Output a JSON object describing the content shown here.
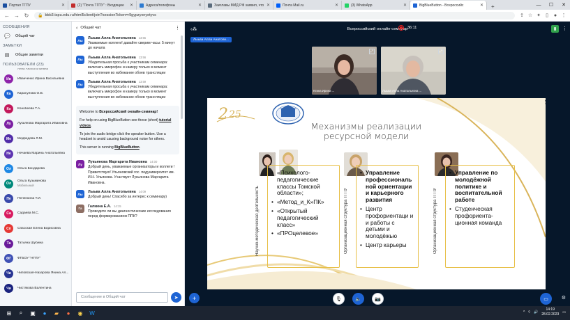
{
  "browser": {
    "tabs": [
      {
        "label": "Портал ТГПУ",
        "color": "#1b4fa0",
        "active": false
      },
      {
        "label": "(2) \"Почта ТГПУ\" : Входящие",
        "color": "#c22d2d",
        "active": false
      },
      {
        "label": "Адреса/телефоны",
        "color": "#2e7bd1",
        "active": false
      },
      {
        "label": "Заиглавы МИД РФ заявил, что",
        "color": "#5a6b7c",
        "active": false
      },
      {
        "label": "Почта Mail.ru",
        "color": "#005ff9",
        "active": false
      },
      {
        "label": "(3) WhatsApp",
        "color": "#25d366",
        "active": false
      },
      {
        "label": "BigBlueButton - Всероссийс",
        "color": "#1e64d4",
        "active": true
      }
    ],
    "url": "bbb3.tspu.edu.ru/html5client/join?sessionToken=r9gypzyxnyetyvs"
  },
  "sidebar": {
    "messages_header": "СООБЩЕНИЯ",
    "public_chat": "Общий чат",
    "notes_header": "ЗАМЕТКИ",
    "shared_notes": "Общие заметки",
    "users_header": "ПОЛЬЗОВАТЕЛИ (23)",
    "partial_user": "Анна Аналатольевна",
    "users": [
      {
        "initials": "Ив",
        "name": "Иванченко Ирина Васильевна",
        "sub": "",
        "color": "#8e24aa",
        "round": true
      },
      {
        "initials": "Ка",
        "name": "Карасулова О.В.",
        "sub": "",
        "color": "#1e64d4",
        "round": true
      },
      {
        "initials": "Ко",
        "name": "Конобеева Т.А.",
        "sub": "",
        "color": "#c2185b",
        "round": true
      },
      {
        "initials": "Лу",
        "name": "Лукьянова Маргарита Ивановна",
        "sub": "",
        "color": "#7b1fa2",
        "round": true
      },
      {
        "initials": "Ме",
        "name": "Медведева Л.М.",
        "sub": "",
        "color": "#512da8",
        "round": true
      },
      {
        "initials": "Не",
        "name": "Нечаева Марина Анатольевна",
        "sub": "",
        "color": "#5e35b1",
        "round": true
      },
      {
        "initials": "Ол",
        "name": "Ольга Бондарева",
        "sub": "",
        "color": "#1e88e5",
        "round": true
      },
      {
        "initials": "Ол",
        "name": "Ольга Кузьминова",
        "sub": "Мобильный",
        "color": "#00897b",
        "round": true
      },
      {
        "initials": "Пе",
        "name": "Пеленкина Т.И.",
        "sub": "",
        "color": "#3949ab",
        "round": true
      },
      {
        "initials": "Са",
        "name": "Садаева М.С.",
        "sub": "",
        "color": "#d81b60",
        "round": true
      },
      {
        "initials": "Сп",
        "name": "Спасская Елена Борисовна",
        "sub": "",
        "color": "#e53935",
        "round": true
      },
      {
        "initials": "Та",
        "name": "Татьяна Шубина",
        "sub": "",
        "color": "#6a1b9a",
        "round": true
      },
      {
        "initials": "ФГ",
        "name": "ФГБОУ \"НГПУ\"",
        "sub": "",
        "color": "#3f51b5",
        "round": true
      },
      {
        "initials": "Чи",
        "name": "Чиповская-Назарова Янина Ал...",
        "sub": "",
        "color": "#283593",
        "round": true
      },
      {
        "initials": "Чи",
        "name": "Чистякова Валентина",
        "sub": "",
        "color": "#1a237e",
        "round": true
      }
    ]
  },
  "chat": {
    "header": "Общий чат",
    "messages_top": [
      {
        "initials": "Лы",
        "name": "Лыьва Алла Анатольевна",
        "time": "13:55",
        "text": "Уважаемые коллеги! давайте сверим часы: 5 минут до начала",
        "color": "#1e64d4"
      },
      {
        "initials": "Лы",
        "name": "Лыьва Алла Анатольевна",
        "time": "13:56",
        "text": "Убедительная просьба к участникам семинара: включать микрофон и камеру только в момент выступления во избежание обоев трансляции",
        "color": "#1e64d4"
      },
      {
        "initials": "Лы",
        "name": "Лыьва Алла Анатольевна",
        "time": "13:59",
        "text": "Убедительная просьба к участникам семинара: включать микрофон и камеру только в момент выступления во избежание обоев трансляции",
        "color": "#1e64d4"
      }
    ],
    "welcome": {
      "line1_prefix": "Welcome to ",
      "line1_bold": "Всероссийский онлайн-семинар!",
      "line2_prefix": "For help on using BigBlueButton see these (short) ",
      "line2_link": "tutorial videos",
      "line2_suffix": ".",
      "line3": "To join the audio bridge click the speaker button. Use a headset to avoid causing background noise for others.",
      "line4_prefix": "This server is running ",
      "line4_link": "BigBlueButton",
      "line4_suffix": "."
    },
    "messages_bottom": [
      {
        "initials": "Лу",
        "name": "Лукьянова Маргарита Ивановна",
        "time": "14:00",
        "text": "Добрый день, уважаемые организаторы и коллеги ! Приветствую! Ульяновский гос. педуниверситет им. И.Н. Ульянова. Участвует Лукьянова Маргарита Ивановна.",
        "color": "#7b1fa2"
      },
      {
        "initials": "Лы",
        "name": "Лыьва Алла Анатольевна",
        "time": "14:09",
        "text": "Добрый день! Спасибо за интерес к семинару)",
        "color": "#1e64d4"
      },
      {
        "initials": "Га",
        "name": "Галкина Е.А.",
        "time": "14:15",
        "text": "Проводите ли вы диагностические исследования перед формированием ППК?",
        "color": "#8d6e63"
      }
    ],
    "input_placeholder": "Сообщение в Общий чат"
  },
  "meeting": {
    "title": "Всероссийский онлайн-семинар",
    "timer": "36:11",
    "presenter": "Лыьва Алла Анатоли..."
  },
  "videos": [
    {
      "name": "Ктина Ирина ..."
    },
    {
      "name": "Лыьва Алла Анатольевна ..."
    }
  ],
  "slide": {
    "title_line1": "Механизмы реализации",
    "title_line2": "ресурсной модели",
    "columns": [
      {
        "vertical": "Научно-методическая деятельность",
        "items": [
          "«Психолого-педагогические классы Томской области»;",
          "«Метод_и_К»ПК»",
          "«Открытый педагогический класс»",
          "«ПРОцелевое»"
        ]
      },
      {
        "vertical": "Организационная структура ТГПУ",
        "items": [
          "Управление профессиональ ной ориентации и карьерного развития",
          "Центр профориентаци и и работы с детьми и молодёжью",
          "Центр карьеры"
        ]
      },
      {
        "vertical": "Организационная структура ТГПУ",
        "items": [
          "Управление по молодёжной политике и воспитательной работе",
          "Студенческая профориента-ционная команда"
        ]
      }
    ]
  },
  "taskbar": {
    "time": "14:19",
    "date": "28.02.2023"
  }
}
